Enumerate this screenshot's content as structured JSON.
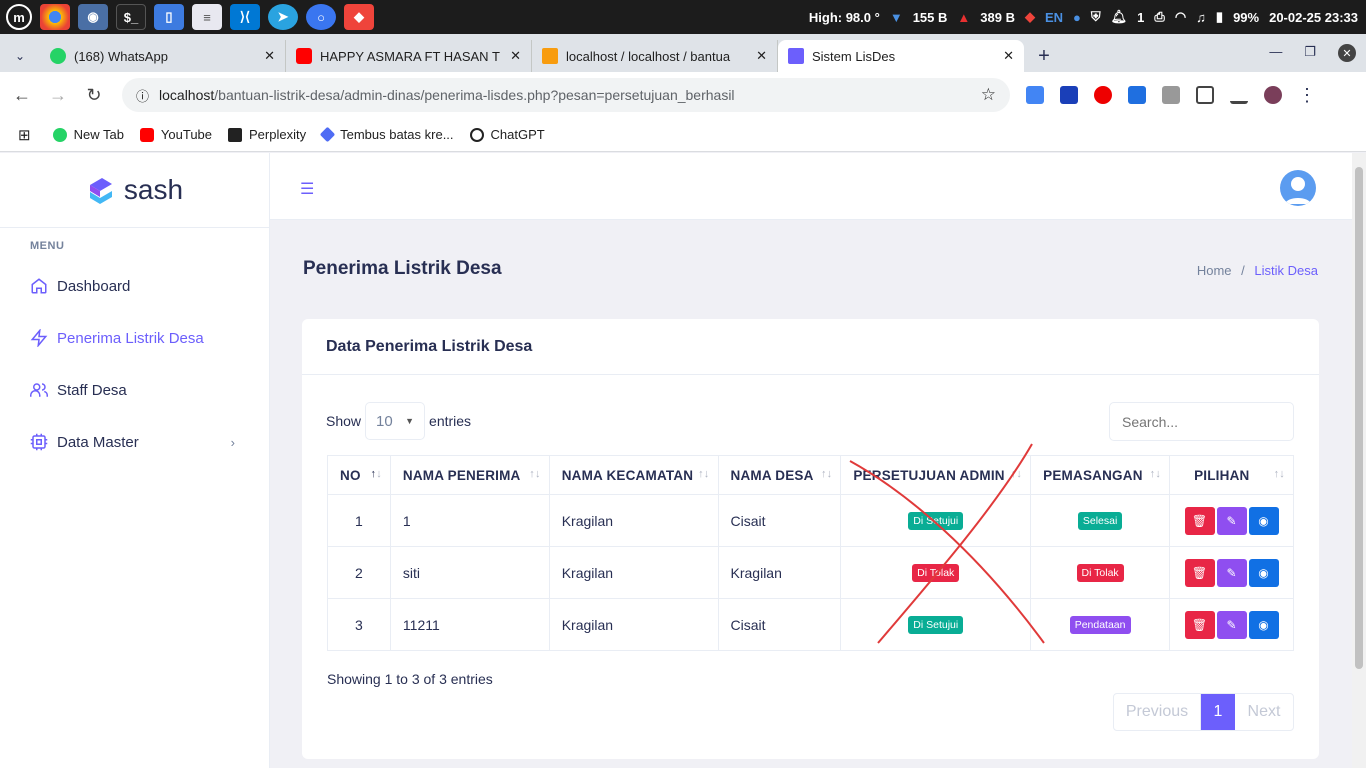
{
  "taskbar": {
    "temp_label": "High: 98.0 °",
    "down_speed": "155  B",
    "up_speed": "389  B",
    "lang": "EN",
    "notif_count": "1",
    "battery": "99%",
    "datetime": "20-02-25 23:33"
  },
  "tabs": [
    {
      "title": "(168) WhatsApp",
      "color": "#25d366"
    },
    {
      "title": "HAPPY ASMARA FT HASAN T",
      "color": "#ff0000"
    },
    {
      "title": "localhost / localhost / bantua",
      "color": "#f89c0e"
    },
    {
      "title": "Sistem LisDes",
      "color": "#6c5ffc"
    }
  ],
  "address": {
    "host": "localhost",
    "path": "/bantuan-listrik-desa/admin-dinas/penerima-lisdes.php?pesan=persetujuan_berhasil"
  },
  "bookmarks": [
    {
      "label": "New Tab",
      "color": "#25d366"
    },
    {
      "label": "YouTube",
      "color": "#ff0000"
    },
    {
      "label": "Perplexity",
      "color": "#222222"
    },
    {
      "label": "Tembus batas kre...",
      "color": "#4f6cf4"
    },
    {
      "label": "ChatGPT",
      "color": "#222222"
    }
  ],
  "app": {
    "brand": "sash",
    "menu_category": "MENU",
    "menu": [
      {
        "label": "Dashboard",
        "icon": "home-icon"
      },
      {
        "label": "Penerima Listrik Desa",
        "icon": "zap-icon"
      },
      {
        "label": "Staff Desa",
        "icon": "users-icon"
      },
      {
        "label": "Data Master",
        "icon": "cpu-icon"
      }
    ],
    "page_title": "Penerima Listrik Desa",
    "breadcrumb": {
      "home": "Home",
      "current": "Listik Desa"
    },
    "card_title": "Data Penerima Listrik Desa",
    "length": {
      "show": "Show",
      "value": "10",
      "entries": "entries"
    },
    "search_placeholder": "Search...",
    "columns": [
      "NO",
      "NAMA PENERIMA",
      "NAMA KECAMATAN",
      "NAMA DESA",
      "PERSETUJUAN ADMIN",
      "PEMASANGAN",
      "PILIHAN"
    ],
    "rows": [
      {
        "no": "1",
        "nama": "1",
        "kecamatan": "Kragilan",
        "desa": "Cisait",
        "admin": "Di Setujui",
        "admin_color": "#09ad95",
        "pemasangan": "Selesai",
        "pemasangan_color": "#09ad95"
      },
      {
        "no": "2",
        "nama": "siti",
        "kecamatan": "Kragilan",
        "desa": "Kragilan",
        "admin": "Di Tolak",
        "admin_color": "#e82646",
        "pemasangan": "Di Tolak",
        "pemasangan_color": "#e82646"
      },
      {
        "no": "3",
        "nama": "11211",
        "kecamatan": "Kragilan",
        "desa": "Cisait",
        "admin": "Di Setujui",
        "admin_color": "#09ad95",
        "pemasangan": "Pendataan",
        "pemasangan_color": "#8f4ef0"
      }
    ],
    "info": "Showing 1 to 3 of 3 entries",
    "pager": {
      "prev": "Previous",
      "current": "1",
      "next": "Next"
    },
    "colors": {
      "primary": "#6c5ffc",
      "danger": "#e82646",
      "purple": "#8f4ef0",
      "blue": "#1170e4"
    }
  }
}
